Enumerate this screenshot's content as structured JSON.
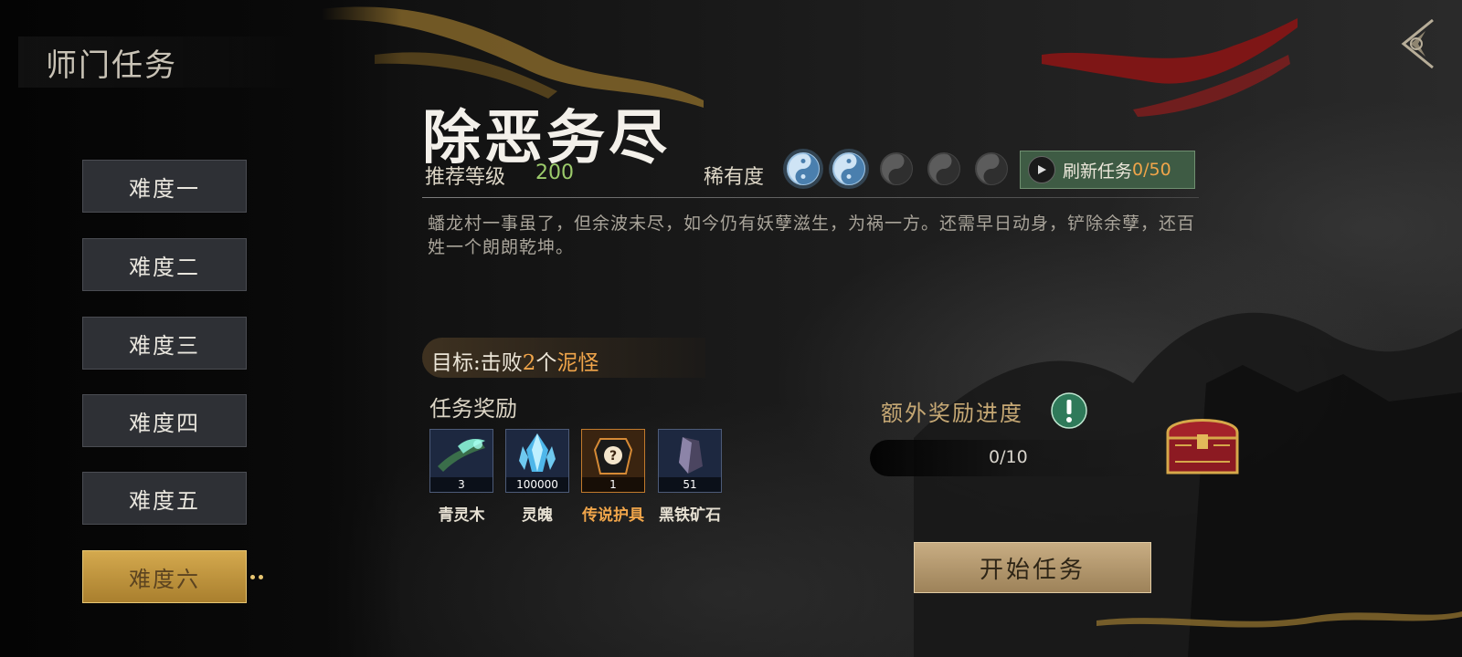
{
  "page": {
    "title": "师门任务"
  },
  "difficulty": {
    "items": [
      "难度一",
      "难度二",
      "难度三",
      "难度四",
      "难度五",
      "难度六"
    ],
    "selected": "难度六"
  },
  "mission": {
    "title": "除恶务尽",
    "recommended_level_label": "推荐等级",
    "recommended_level": "200",
    "rarity_label": "稀有度",
    "rarity": 2,
    "rarity_max": 5,
    "refresh_label": "刷新任务",
    "refresh_count": "0/50",
    "description": "蟠龙村一事虽了，但余波未尽，如今仍有妖孽滋生，为祸一方。还需早日动身，铲除余孽，还百姓一个朗朗乾坤。",
    "goal_prefix": "目标:击败",
    "goal_count": "2",
    "goal_unit": "个",
    "goal_target": "泥怪"
  },
  "rewards": {
    "label": "任务奖励",
    "items": [
      {
        "name": "青灵木",
        "count": "3",
        "icon": "green-wood-icon",
        "rarity": "normal"
      },
      {
        "name": "灵魄",
        "count": "100000",
        "icon": "blue-crystal-icon",
        "rarity": "normal"
      },
      {
        "name": "传说护具",
        "count": "1",
        "icon": "mystery-armor-icon",
        "rarity": "legend"
      },
      {
        "name": "黑铁矿石",
        "count": "51",
        "icon": "black-iron-ore-icon",
        "rarity": "normal"
      }
    ]
  },
  "extra_reward": {
    "label": "额外奖励进度",
    "progress_text": "0/10",
    "progress": 0
  },
  "actions": {
    "start_label": "开始任务"
  },
  "colors": {
    "accent_gold": "#d4a94e",
    "highlight_orange": "#f0a54a",
    "level_green": "#9ccb6b",
    "refresh_green": "#3e5b44"
  }
}
